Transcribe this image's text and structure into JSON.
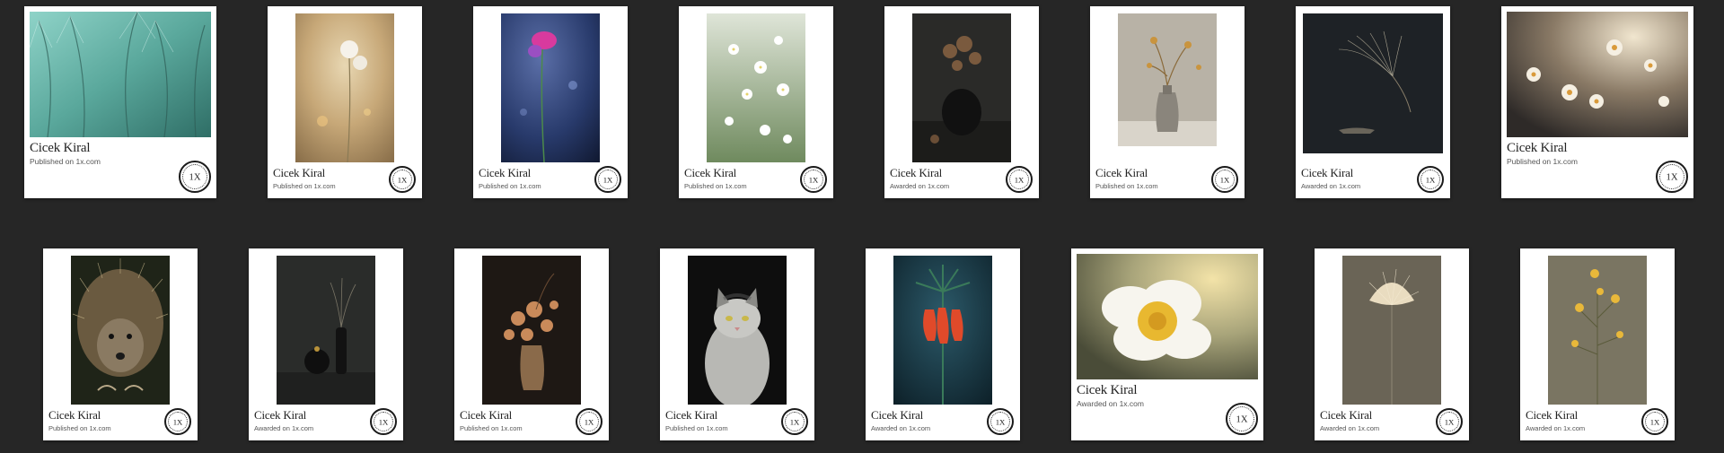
{
  "gallery": {
    "items": [
      {
        "name": "Cicek Kiral",
        "status": "Published on 1x.com",
        "badge_label": "1X",
        "subject": "teal dandelion seeds"
      },
      {
        "name": "Cicek Kiral",
        "status": "Published on 1x.com",
        "badge_label": "1X",
        "subject": "white flowers golden bokeh"
      },
      {
        "name": "Cicek Kiral",
        "status": "Published on 1x.com",
        "badge_label": "1X",
        "subject": "pink columbine blue background"
      },
      {
        "name": "Cicek Kiral",
        "status": "Published on 1x.com",
        "badge_label": "1X",
        "subject": "white meadow flowers"
      },
      {
        "name": "Cicek Kiral",
        "status": "Awarded on 1x.com",
        "badge_label": "1X",
        "subject": "dried flowers in dark vase"
      },
      {
        "name": "Cicek Kiral",
        "status": "Published on 1x.com",
        "badge_label": "1X",
        "subject": "dried twig in gray vase"
      },
      {
        "name": "Cicek Kiral",
        "status": "Awarded on 1x.com",
        "badge_label": "1X",
        "subject": "feathery grass on dark"
      },
      {
        "name": "Cicek Kiral",
        "status": "Published on 1x.com",
        "badge_label": "1X",
        "subject": "backlit daisies"
      },
      {
        "name": "Cicek Kiral",
        "status": "Published on 1x.com",
        "badge_label": "1X",
        "subject": "hedgehog"
      },
      {
        "name": "Cicek Kiral",
        "status": "Awarded on 1x.com",
        "badge_label": "1X",
        "subject": "dark vases still life"
      },
      {
        "name": "Cicek Kiral",
        "status": "Published on 1x.com",
        "badge_label": "1X",
        "subject": "dried roses in vase"
      },
      {
        "name": "Cicek Kiral",
        "status": "Published on 1x.com",
        "badge_label": "1X",
        "subject": "white cat"
      },
      {
        "name": "Cicek Kiral",
        "status": "Awarded on 1x.com",
        "badge_label": "1X",
        "subject": "red fritillaria"
      },
      {
        "name": "Cicek Kiral",
        "status": "Awarded on 1x.com",
        "badge_label": "1X",
        "subject": "white rose yellow center"
      },
      {
        "name": "Cicek Kiral",
        "status": "Awarded on 1x.com",
        "badge_label": "1X",
        "subject": "dandelion puff"
      },
      {
        "name": "Cicek Kiral",
        "status": "Awarded on 1x.com",
        "badge_label": "1X",
        "subject": "yellow wildflowers"
      }
    ]
  },
  "colors": {
    "background": "#262626",
    "card": "#ffffff",
    "text_primary": "#222222",
    "text_secondary": "#555555"
  }
}
